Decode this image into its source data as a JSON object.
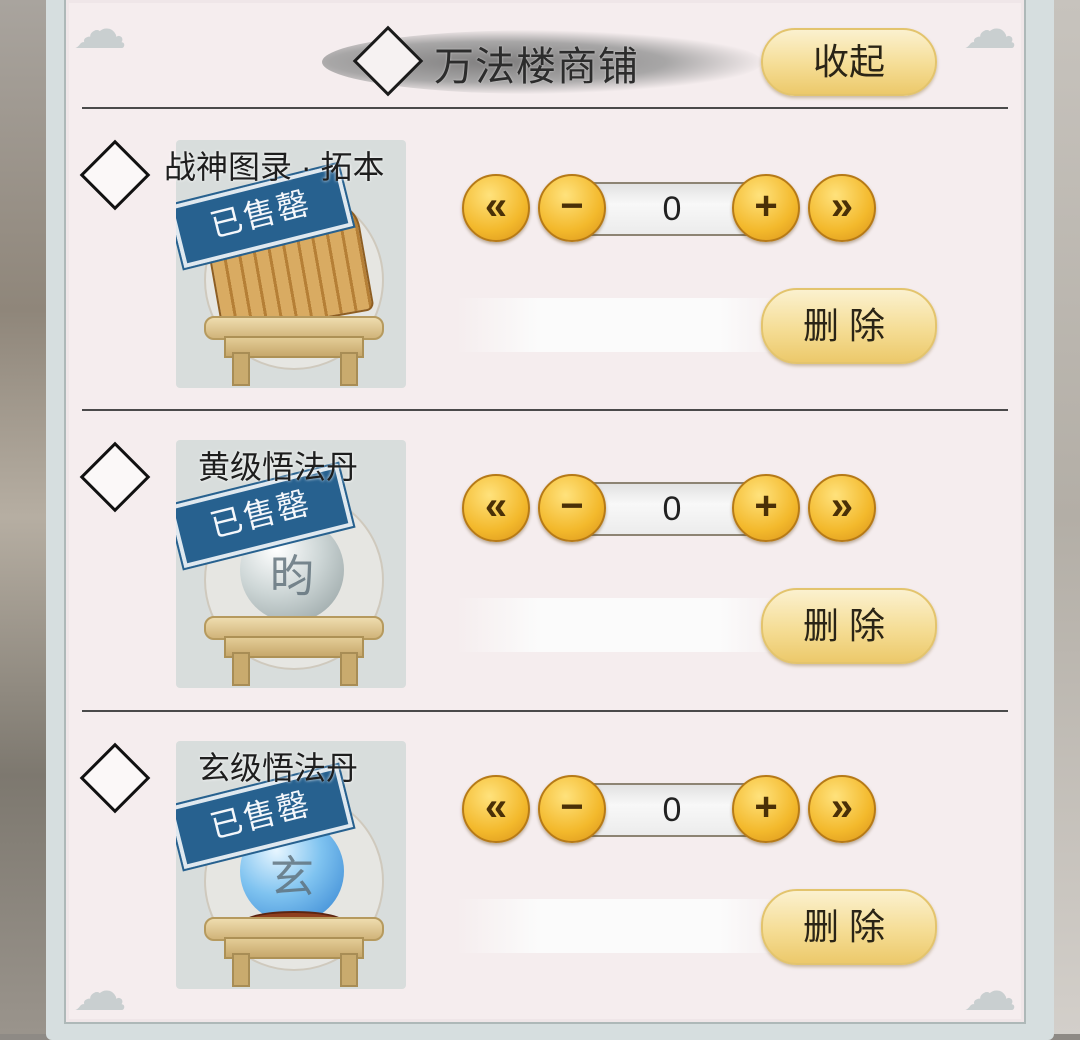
{
  "shop": {
    "title": "万法楼商铺",
    "collapse_label": "收起"
  },
  "controls": {
    "first_symbol": "«",
    "minus_symbol": "−",
    "plus_symbol": "+",
    "last_symbol": "»",
    "delete_label": "删除"
  },
  "items": [
    {
      "name": "战神图录 · 拓本",
      "quantity": "0",
      "sold_stamp": "已售罄",
      "icon": "scroll-icon"
    },
    {
      "name": "黄级悟法丹",
      "quantity": "0",
      "sold_stamp": "已售罄",
      "icon": "silver-pill-icon",
      "orb_glyph": "昀"
    },
    {
      "name": "玄级悟法丹",
      "quantity": "0",
      "sold_stamp": "已售罄",
      "icon": "blue-pill-icon",
      "orb_glyph": "玄"
    }
  ]
}
